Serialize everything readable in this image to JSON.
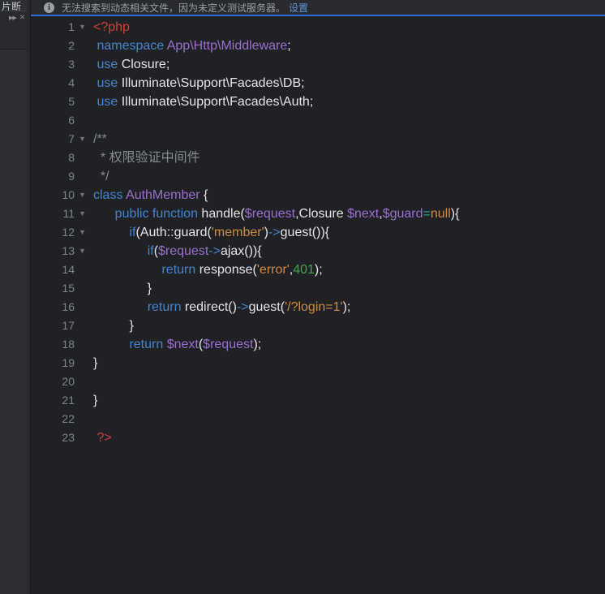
{
  "sidebar": {
    "tab_label": "片断",
    "run_icon": "▶▶",
    "close_icon": "✕"
  },
  "notification": {
    "info_icon": "i",
    "message": "无法搜索到动态相关文件，因为未定义测试服务器。",
    "settings_link": "设置"
  },
  "colors": {
    "accent_blue": "#2f6fd6",
    "link_blue": "#5f96dd",
    "keyword_blue": "#4585cf",
    "purple": "#9a70cf",
    "string_orange": "#d28b3f",
    "number_green": "#3fa94c",
    "php_tag_red": "#d1403a",
    "comment_gray": "#878b92",
    "editor_bg": "#202124",
    "sidebar_bg": "#2e2f32"
  },
  "editor": {
    "fold_icon": "▼",
    "lines": [
      {
        "num": 1,
        "fold": true,
        "segs": [
          [
            "red",
            "<?php"
          ]
        ]
      },
      {
        "num": 2,
        "fold": false,
        "segs": [
          [
            "plain",
            " "
          ],
          [
            "kw",
            "namespace"
          ],
          [
            "plain",
            " "
          ],
          [
            "pp",
            "App\\Http\\Middleware"
          ],
          [
            "plain",
            ";"
          ]
        ]
      },
      {
        "num": 3,
        "fold": false,
        "segs": [
          [
            "plain",
            " "
          ],
          [
            "kw",
            "use"
          ],
          [
            "plain",
            " Closure;"
          ]
        ]
      },
      {
        "num": 4,
        "fold": false,
        "segs": [
          [
            "plain",
            " "
          ],
          [
            "kw",
            "use"
          ],
          [
            "plain",
            " Illuminate\\Support\\Facades\\DB;"
          ]
        ]
      },
      {
        "num": 5,
        "fold": false,
        "segs": [
          [
            "plain",
            " "
          ],
          [
            "kw",
            "use"
          ],
          [
            "plain",
            " Illuminate\\Support\\Facades\\Auth;"
          ]
        ]
      },
      {
        "num": 6,
        "fold": false,
        "segs": []
      },
      {
        "num": 7,
        "fold": true,
        "segs": [
          [
            "cmt",
            "/**"
          ]
        ]
      },
      {
        "num": 8,
        "fold": false,
        "segs": [
          [
            "cmt",
            "  * 权限验证中间件"
          ]
        ]
      },
      {
        "num": 9,
        "fold": false,
        "segs": [
          [
            "cmt",
            "  */"
          ]
        ]
      },
      {
        "num": 10,
        "fold": true,
        "segs": [
          [
            "kw",
            "class"
          ],
          [
            "plain",
            " "
          ],
          [
            "pp",
            "AuthMember"
          ],
          [
            "plain",
            " {"
          ]
        ]
      },
      {
        "num": 11,
        "fold": true,
        "segs": [
          [
            "plain",
            "      "
          ],
          [
            "kw",
            "public function"
          ],
          [
            "plain",
            " handle("
          ],
          [
            "pp",
            "$request"
          ],
          [
            "plain",
            ",Closure "
          ],
          [
            "pp",
            "$next"
          ],
          [
            "plain",
            ","
          ],
          [
            "pp",
            "$guard"
          ],
          [
            "teal",
            "="
          ],
          [
            "str",
            "null"
          ],
          [
            "plain",
            "){"
          ]
        ]
      },
      {
        "num": 12,
        "fold": true,
        "segs": [
          [
            "plain",
            "          "
          ],
          [
            "kw",
            "if"
          ],
          [
            "plain",
            "(Auth::guard("
          ],
          [
            "str",
            "'member'"
          ],
          [
            "plain",
            ")"
          ],
          [
            "kw",
            "->"
          ],
          [
            "plain",
            "guest()){"
          ]
        ]
      },
      {
        "num": 13,
        "fold": true,
        "segs": [
          [
            "plain",
            "               "
          ],
          [
            "kw",
            "if"
          ],
          [
            "plain",
            "("
          ],
          [
            "pp",
            "$request"
          ],
          [
            "kw",
            "->"
          ],
          [
            "plain",
            "ajax()){"
          ]
        ]
      },
      {
        "num": 14,
        "fold": false,
        "segs": [
          [
            "plain",
            "                   "
          ],
          [
            "kw",
            "return"
          ],
          [
            "plain",
            " response("
          ],
          [
            "str",
            "'error'"
          ],
          [
            "plain",
            ","
          ],
          [
            "num",
            "401"
          ],
          [
            "plain",
            ");"
          ]
        ]
      },
      {
        "num": 15,
        "fold": false,
        "segs": [
          [
            "plain",
            "               }"
          ]
        ]
      },
      {
        "num": 16,
        "fold": false,
        "segs": [
          [
            "plain",
            "               "
          ],
          [
            "kw",
            "return"
          ],
          [
            "plain",
            " redirect()"
          ],
          [
            "kw",
            "->"
          ],
          [
            "plain",
            "guest("
          ],
          [
            "str",
            "'/?login=1'"
          ],
          [
            "plain",
            ");"
          ]
        ]
      },
      {
        "num": 17,
        "fold": false,
        "segs": [
          [
            "plain",
            "          }"
          ]
        ]
      },
      {
        "num": 18,
        "fold": false,
        "segs": [
          [
            "plain",
            "          "
          ],
          [
            "kw",
            "return"
          ],
          [
            "plain",
            " "
          ],
          [
            "pp",
            "$next"
          ],
          [
            "plain",
            "("
          ],
          [
            "pp",
            "$request"
          ],
          [
            "plain",
            ");"
          ]
        ]
      },
      {
        "num": 19,
        "fold": false,
        "segs": [
          [
            "plain",
            "}"
          ]
        ]
      },
      {
        "num": 20,
        "fold": false,
        "segs": []
      },
      {
        "num": 21,
        "fold": false,
        "segs": [
          [
            "plain",
            "}"
          ]
        ]
      },
      {
        "num": 22,
        "fold": false,
        "segs": []
      },
      {
        "num": 23,
        "fold": false,
        "segs": [
          [
            "plain",
            " "
          ],
          [
            "red",
            "?>"
          ]
        ]
      }
    ]
  }
}
